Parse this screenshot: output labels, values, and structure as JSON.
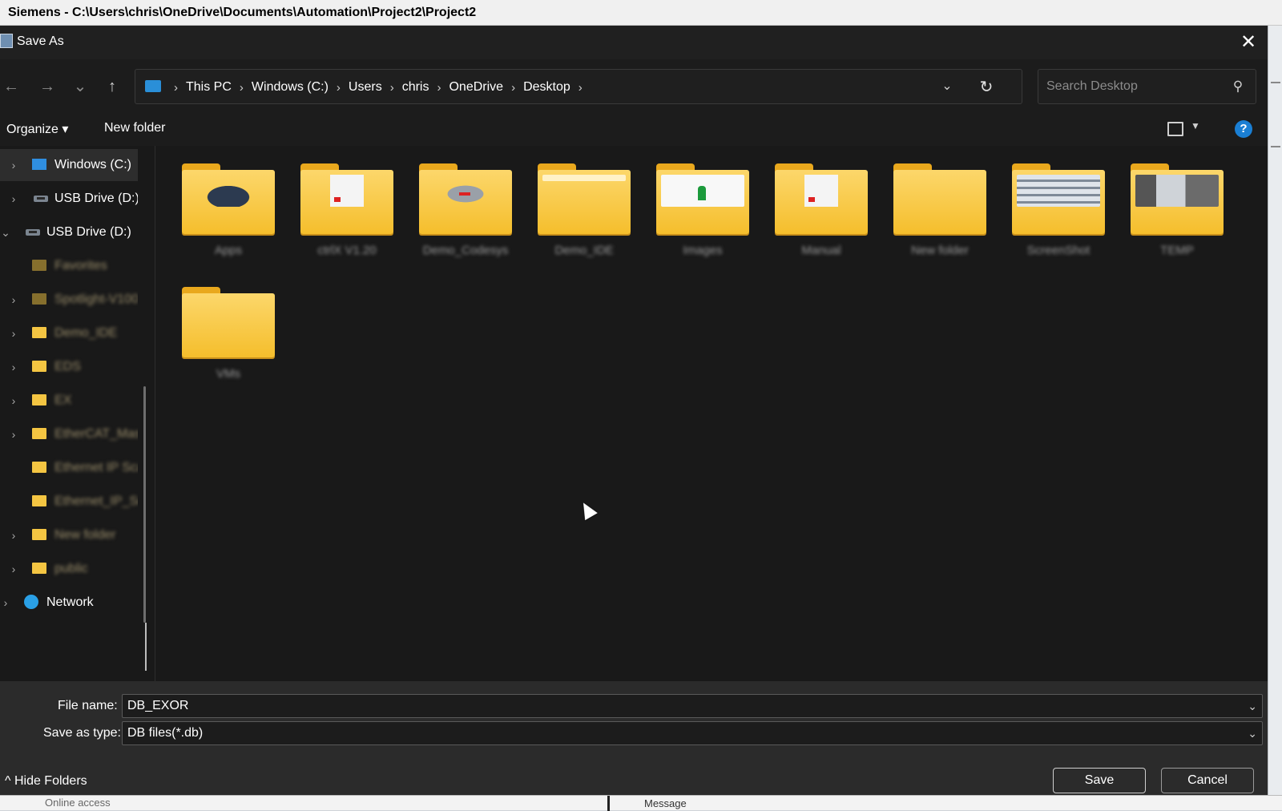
{
  "background_app": {
    "title": "Siemens  -  C:\\Users\\chris\\OneDrive\\Documents\\Automation\\Project2\\Project2",
    "status_left": "Online access",
    "status_right": "Message"
  },
  "dialog": {
    "title": "Save As",
    "close_glyph": "✕"
  },
  "nav": {
    "back_glyph": "←",
    "forward_glyph": "→",
    "recent_glyph": "⌄",
    "up_glyph": "↑",
    "breadcrumbs": [
      "This PC",
      "Windows (C:)",
      "Users",
      "chris",
      "OneDrive",
      "Desktop"
    ],
    "crumb_sep": "›",
    "dropdown_glyph": "⌄",
    "refresh_glyph": "↻"
  },
  "search": {
    "placeholder": "Search Desktop",
    "icon": "⚲"
  },
  "toolbar": {
    "organize_label": "Organize ▾",
    "new_folder_label": "New folder",
    "view_dropdown": "▼",
    "help_label": "?"
  },
  "sidebar": {
    "items": [
      {
        "label": "Windows (C:)",
        "icon": "windows-drive-icon",
        "expanded": false,
        "selected": true
      },
      {
        "label": "USB Drive (D:)",
        "icon": "usb-drive-icon",
        "expanded": false
      },
      {
        "label": "USB Drive (D:)",
        "icon": "usb-drive-icon",
        "expanded": true
      },
      {
        "label": "Favorites",
        "icon": "folder-icon",
        "blurred": true
      },
      {
        "label": "Spotlight-V100",
        "icon": "folder-icon",
        "blurred": true
      },
      {
        "label": "Demo_IDE",
        "icon": "folder-icon",
        "blurred": true
      },
      {
        "label": "EDS",
        "icon": "folder-icon",
        "blurred": true
      },
      {
        "label": "EX",
        "icon": "folder-icon",
        "blurred": true
      },
      {
        "label": "EtherCAT_Mas",
        "icon": "folder-icon",
        "blurred": true
      },
      {
        "label": "Ethernet IP Sca",
        "icon": "folder-icon",
        "blurred": true
      },
      {
        "label": "Ethernet_IP_Sc",
        "icon": "folder-icon",
        "blurred": true
      },
      {
        "label": "New folder",
        "icon": "folder-icon",
        "blurred": true
      },
      {
        "label": "public",
        "icon": "folder-icon",
        "blurred": true
      },
      {
        "label": "Network",
        "icon": "network-icon",
        "expanded": false
      }
    ],
    "chevron_right": "›",
    "chevron_down": "⌄"
  },
  "files": [
    {
      "name": "Apps",
      "thumb": "dark-logo"
    },
    {
      "name": "ctrlX V1.20",
      "thumb": "doc-red"
    },
    {
      "name": "Demo_Codesys",
      "thumb": "grey-red"
    },
    {
      "name": "Demo_IDE",
      "thumb": "white-strip"
    },
    {
      "name": "Images",
      "thumb": "white-green"
    },
    {
      "name": "Manual",
      "thumb": "doc-red"
    },
    {
      "name": "New folder",
      "thumb": "none"
    },
    {
      "name": "ScreenShot",
      "thumb": "screen"
    },
    {
      "name": "TEMP",
      "thumb": "photo"
    },
    {
      "name": "VMs",
      "thumb": "none"
    }
  ],
  "form": {
    "file_name_label": "File name:",
    "file_name_value": "DB_EXOR",
    "save_type_label": "Save as type:",
    "save_type_value": "DB files(*.db)",
    "dropdown_glyph": "⌄"
  },
  "footer": {
    "hide_folders_label": "^  Hide Folders",
    "save_label": "Save",
    "cancel_label": "Cancel"
  }
}
